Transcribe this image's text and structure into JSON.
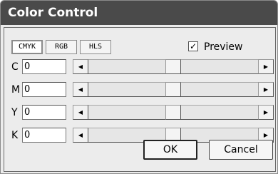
{
  "window": {
    "title": "Color Control"
  },
  "tabs": [
    {
      "label": "CMYK",
      "active": true
    },
    {
      "label": "RGB",
      "active": false
    },
    {
      "label": "HLS",
      "active": false
    }
  ],
  "preview": {
    "label": "Preview",
    "checked": true,
    "check_glyph": "✓"
  },
  "channels": [
    {
      "label": "C",
      "value": "0",
      "slider_fraction": 0.5
    },
    {
      "label": "M",
      "value": "0",
      "slider_fraction": 0.5
    },
    {
      "label": "Y",
      "value": "0",
      "slider_fraction": 0.5
    },
    {
      "label": "K",
      "value": "0",
      "slider_fraction": 0.5
    }
  ],
  "scroll_arrows": {
    "left": "◀",
    "right": "▶"
  },
  "buttons": {
    "ok": "OK",
    "cancel": "Cancel"
  }
}
